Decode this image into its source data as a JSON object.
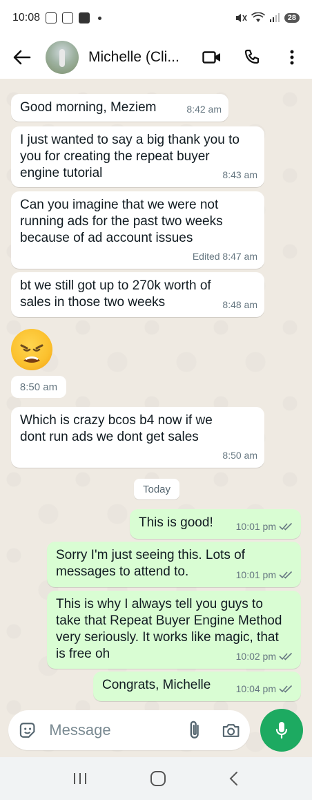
{
  "status_bar": {
    "time": "10:08",
    "battery": "28"
  },
  "header": {
    "contact_name": "Michelle (Cli..."
  },
  "messages": [
    {
      "text": "Good morning, Meziem",
      "time": "8:42 am"
    },
    {
      "text": "I just wanted to say a big thank you to you for creating the repeat buyer engine tutorial",
      "time": "8:43 am"
    },
    {
      "text": "Can you imagine that we were not running ads for the past two weeks because of ad account issues",
      "time": "Edited 8:47 am"
    },
    {
      "text": "bt we still got up to 270k worth of sales in those two weeks",
      "time": "8:48 am"
    },
    {
      "text": "8:50 am"
    },
    {
      "text": "Which is crazy bcos b4 now if we dont run ads we dont get sales",
      "time": "8:50 am"
    }
  ],
  "day_divider": "Today",
  "outgoing": [
    {
      "text": "This is good!",
      "time": "10:01 pm"
    },
    {
      "text": "Sorry I'm just seeing this. Lots of messages to attend to.",
      "time": "10:01 pm"
    },
    {
      "text": "This is why I always tell you guys to take that Repeat Buyer Engine Method very seriously. It works like magic, that is free oh",
      "time": "10:02 pm"
    },
    {
      "text": "Congrats, Michelle",
      "time": "10:04 pm"
    }
  ],
  "composer": {
    "placeholder": "Message"
  },
  "colors": {
    "accent": "#1daa61",
    "outgoing_bubble": "#d9fdd3",
    "chat_bg": "#efeae2"
  }
}
